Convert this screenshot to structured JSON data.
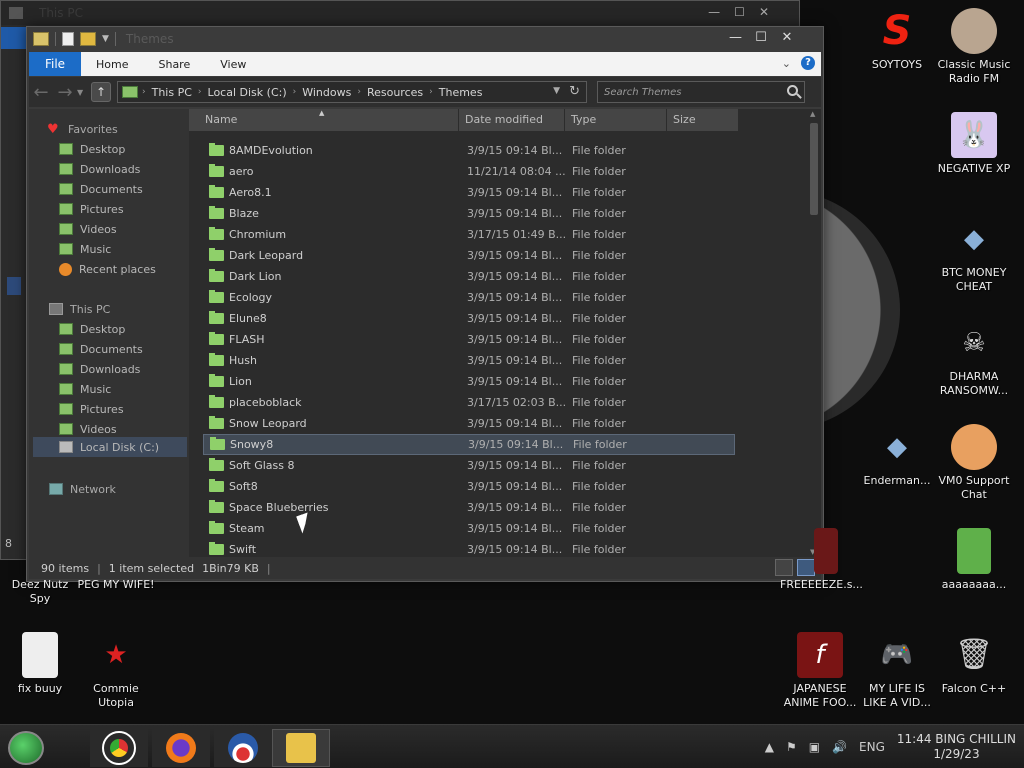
{
  "background_window": {
    "title": "This PC",
    "status_fragment": "8"
  },
  "window": {
    "title": "Themes",
    "ribbon": {
      "file": "File",
      "tabs": [
        "Home",
        "Share",
        "View"
      ]
    },
    "address": {
      "crumbs": [
        "This PC",
        "Local Disk (C:)",
        "Windows",
        "Resources",
        "Themes"
      ]
    },
    "search": {
      "placeholder": "Search Themes"
    },
    "nav": {
      "favorites": {
        "label": "Favorites",
        "items": [
          "Desktop",
          "Downloads",
          "Documents",
          "Pictures",
          "Videos",
          "Music",
          "Recent places"
        ]
      },
      "this_pc": {
        "label": "This PC",
        "items": [
          "Desktop",
          "Documents",
          "Downloads",
          "Music",
          "Pictures",
          "Videos",
          "Local Disk (C:)"
        ]
      },
      "network": "Network"
    },
    "columns": {
      "name": "Name",
      "date": "Date modified",
      "type": "Type",
      "size": "Size"
    },
    "files": [
      {
        "name": "8AMDEvolution",
        "date": "3/9/15 09:14 Bl...",
        "type": "File folder"
      },
      {
        "name": "aero",
        "date": "11/21/14 08:04 ...",
        "type": "File folder"
      },
      {
        "name": "Aero8.1",
        "date": "3/9/15 09:14 Bl...",
        "type": "File folder"
      },
      {
        "name": "Blaze",
        "date": "3/9/15 09:14 Bl...",
        "type": "File folder"
      },
      {
        "name": "Chromium",
        "date": "3/17/15 01:49 B...",
        "type": "File folder"
      },
      {
        "name": "Dark Leopard",
        "date": "3/9/15 09:14 Bl...",
        "type": "File folder"
      },
      {
        "name": "Dark Lion",
        "date": "3/9/15 09:14 Bl...",
        "type": "File folder"
      },
      {
        "name": "Ecology",
        "date": "3/9/15 09:14 Bl...",
        "type": "File folder"
      },
      {
        "name": "Elune8",
        "date": "3/9/15 09:14 Bl...",
        "type": "File folder"
      },
      {
        "name": "FLASH",
        "date": "3/9/15 09:14 Bl...",
        "type": "File folder"
      },
      {
        "name": "Hush",
        "date": "3/9/15 09:14 Bl...",
        "type": "File folder"
      },
      {
        "name": "Lion",
        "date": "3/9/15 09:14 Bl...",
        "type": "File folder"
      },
      {
        "name": "placeboblack",
        "date": "3/17/15 02:03 B...",
        "type": "File folder"
      },
      {
        "name": "Snow Leopard",
        "date": "3/9/15 09:14 Bl...",
        "type": "File folder"
      },
      {
        "name": "Snowy8",
        "date": "3/9/15 09:14 Bl...",
        "type": "File folder",
        "selected": true
      },
      {
        "name": "Soft Glass 8",
        "date": "3/9/15 09:14 Bl...",
        "type": "File folder"
      },
      {
        "name": "Soft8",
        "date": "3/9/15 09:14 Bl...",
        "type": "File folder"
      },
      {
        "name": "Space Blueberries",
        "date": "3/9/15 09:14 Bl...",
        "type": "File folder"
      },
      {
        "name": "Steam",
        "date": "3/9/15 09:14 Bl...",
        "type": "File folder"
      },
      {
        "name": "Swift",
        "date": "3/9/15 09:14 Bl...",
        "type": "File folder"
      }
    ],
    "status": {
      "items": "90 items",
      "selected": "1 item selected",
      "size": "1Bin79 KB"
    }
  },
  "desktop_icons": {
    "soytoys": "SOYTOYS",
    "classic_music": "Classic Music Radio FM",
    "negative_xp": "NEGATIVE XP",
    "btc": "BTC MONEY CHEAT",
    "dharma": "DHARMA RANSOMW...",
    "enderman": "Enderman...",
    "vm0": "VM0 Support Chat",
    "freeze": "FREEEEEZE.s...",
    "aaaa": "aaaaaaaa...",
    "deez": "Deez Nutz Spy",
    "peg": "PEG MY WIFE!",
    "fix": "fix buuy",
    "commie": "Commie Utopia",
    "japanese": "JAPANESE ANIME FOO...",
    "mylife": "MY LIFE IS LIKE A VID...",
    "falcon": "Falcon C++"
  },
  "taskbar": {
    "lang": "ENG",
    "time": "11:44 BING CHILLIN",
    "date": "1/29/23"
  }
}
